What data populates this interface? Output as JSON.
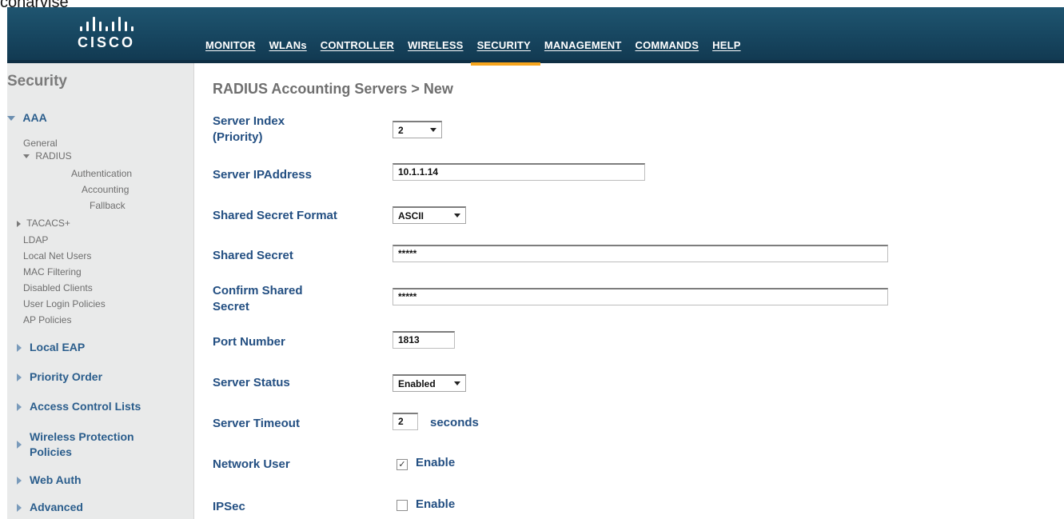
{
  "cropped_caption": "conarvise",
  "brand": {
    "logo_text": "CISCO"
  },
  "nav": {
    "items": [
      "MONITOR",
      "WLANs",
      "CONTROLLER",
      "WIRELESS",
      "SECURITY",
      "MANAGEMENT",
      "COMMANDS",
      "HELP"
    ],
    "active": "SECURITY"
  },
  "sidebar": {
    "title": "Security",
    "aaa": "AAA",
    "aaa_items": {
      "general": "General",
      "radius": "RADIUS",
      "authentication": "Authentication",
      "accounting": "Accounting",
      "fallback": "Fallback",
      "tacacs": "TACACS+",
      "ldap": "LDAP",
      "local_net_users": "Local Net Users",
      "mac_filtering": "MAC Filtering",
      "disabled_clients": "Disabled Clients",
      "user_login_policies": "User Login Policies",
      "ap_policies": "AP Policies"
    },
    "sections": {
      "local_eap": "Local EAP",
      "priority_order": "Priority Order",
      "access_control_lists": "Access Control Lists",
      "wireless_protection_line1": "Wireless Protection",
      "wireless_protection_line2": "Policies",
      "web_auth": "Web Auth",
      "advanced": "Advanced"
    }
  },
  "main": {
    "title": "RADIUS Accounting Servers > New",
    "server_index_label_1": "Server Index",
    "server_index_label_2": "(Priority)",
    "server_index_value": "2",
    "server_ip_label": "Server IPAddress",
    "server_ip_value": "10.1.1.14",
    "secret_format_label": "Shared Secret Format",
    "secret_format_value": "ASCII",
    "shared_secret_label": "Shared Secret",
    "shared_secret_value": "*****",
    "confirm_secret_label_1": "Confirm Shared",
    "confirm_secret_label_2": "Secret",
    "confirm_secret_value": "*****",
    "port_label": "Port Number",
    "port_value": "1813",
    "status_label": "Server Status",
    "status_value": "Enabled",
    "timeout_label": "Server Timeout",
    "timeout_value": "2",
    "timeout_unit": "seconds",
    "network_user_label": "Network User",
    "network_user_checked": true,
    "network_user_option": "Enable",
    "ipsec_label": "IPSec",
    "ipsec_checked": false,
    "ipsec_option": "Enable"
  }
}
